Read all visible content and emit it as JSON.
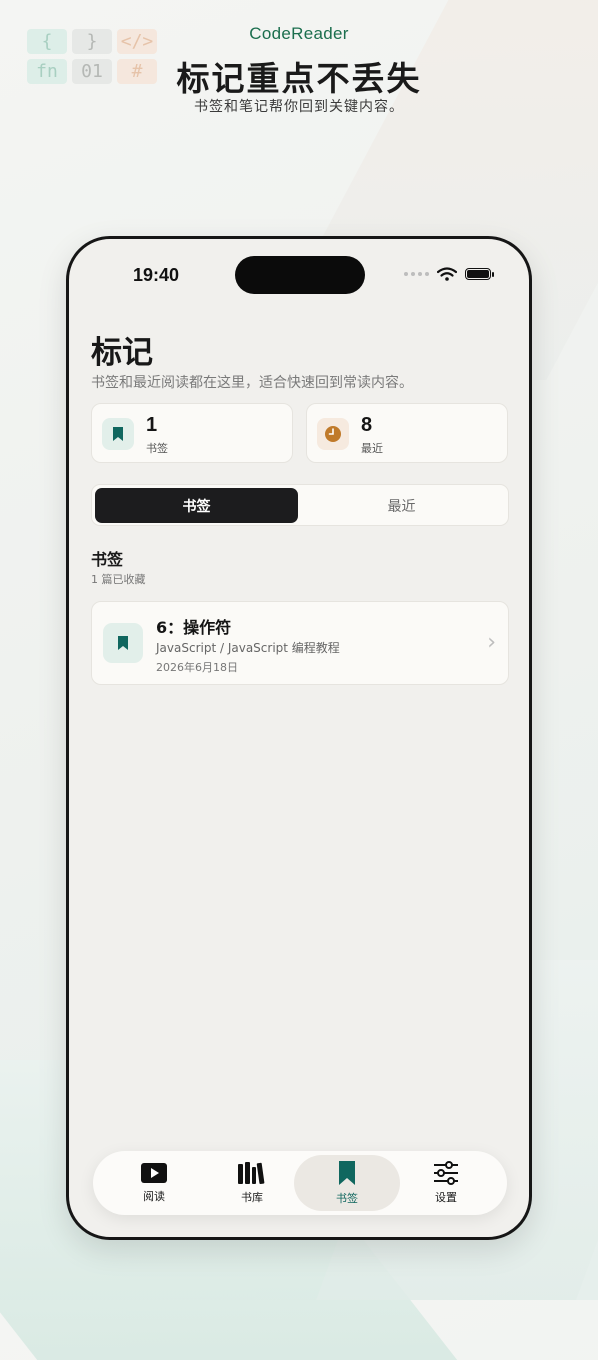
{
  "banner": {
    "deco_tokens": [
      "{",
      "}",
      "</>",
      "fn",
      "01",
      "#"
    ],
    "brand": "CodeReader",
    "headline": "标记重点不丢失",
    "subline": "书签和笔记帮你回到关键内容。"
  },
  "status_bar": {
    "time": "19:40"
  },
  "page": {
    "title": "标记",
    "description": "书签和最近阅读都在这里，适合快速回到常读内容。"
  },
  "stats": [
    {
      "value": "1",
      "label": "书签",
      "icon": "bookmark-icon"
    },
    {
      "value": "8",
      "label": "最近",
      "icon": "clock-icon"
    }
  ],
  "segments": {
    "active": "书签",
    "inactive": "最近"
  },
  "section": {
    "title": "书签",
    "subtitle": "1 篇已收藏"
  },
  "bookmarks": [
    {
      "title": "6：操作符",
      "path": "JavaScript / JavaScript 编程教程",
      "date": "2026年6月18日"
    }
  ],
  "tabbar": [
    {
      "label": "阅读",
      "icon": "play-icon"
    },
    {
      "label": "书库",
      "icon": "library-icon"
    },
    {
      "label": "书签",
      "icon": "bookmark-icon"
    },
    {
      "label": "设置",
      "icon": "sliders-icon"
    }
  ],
  "colors": {
    "accent": "#10675f",
    "brand": "#1b6e4e",
    "clock": "#c07a2a",
    "active_segment": "#1c1c1e"
  }
}
